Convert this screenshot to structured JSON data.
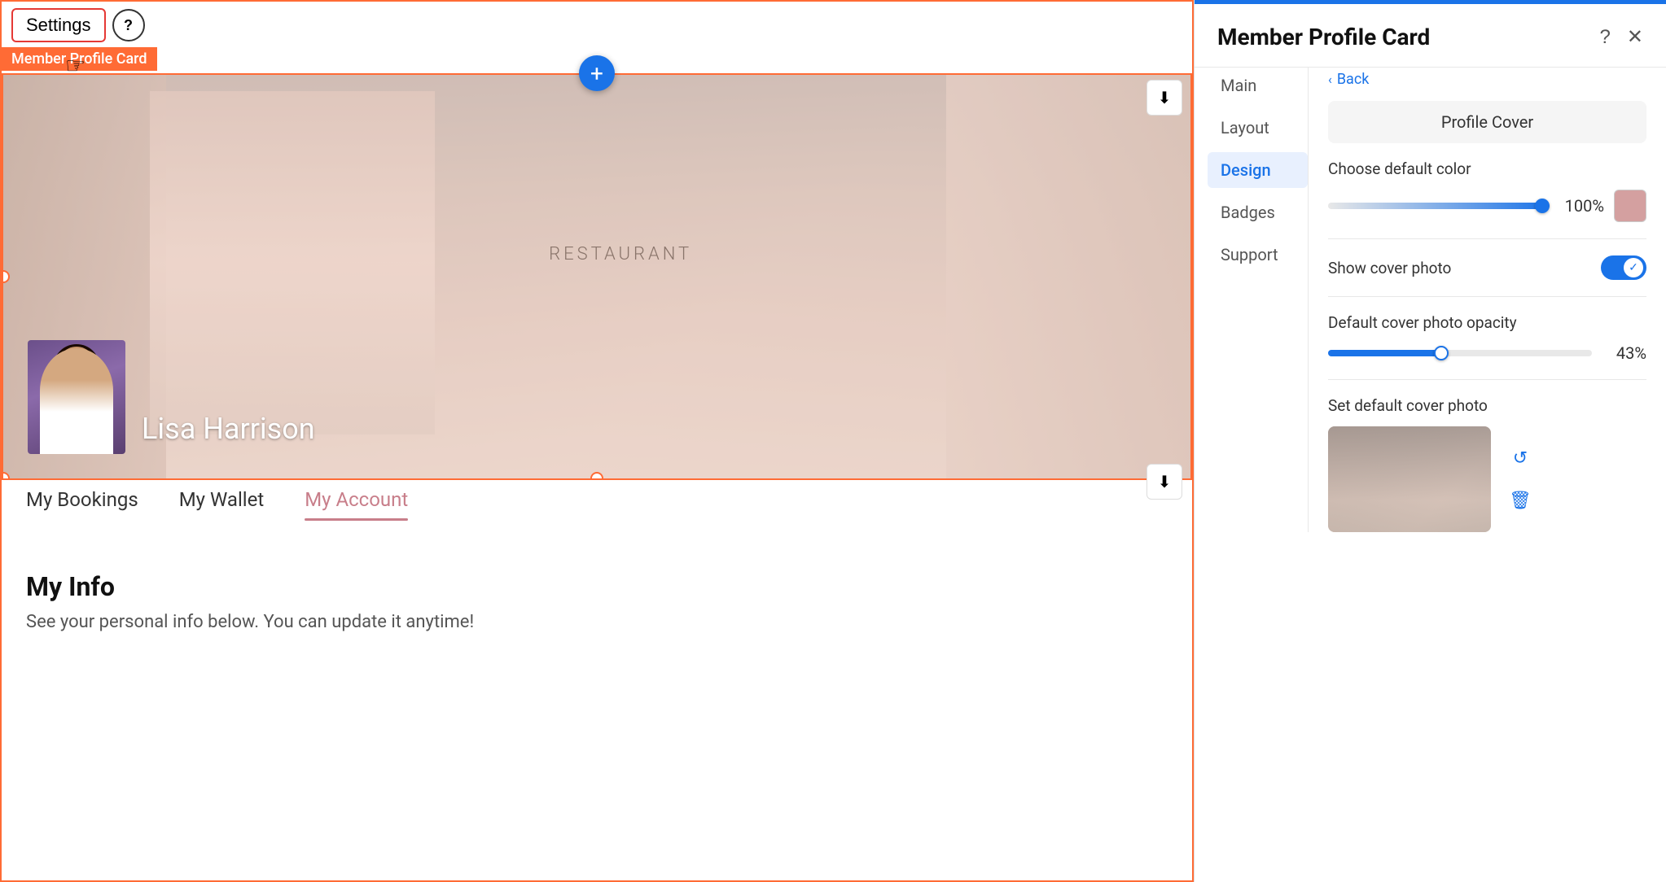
{
  "toolbar": {
    "settings_label": "Settings",
    "help_label": "?",
    "widget_label": "Member Profile Card"
  },
  "cover": {
    "restaurant_text": "RESTAURANT",
    "profile_name": "Lisa Harrison",
    "add_btn": "+",
    "download_symbol": "⬇"
  },
  "tabs": {
    "items": [
      {
        "label": "My Bookings",
        "active": false
      },
      {
        "label": "My Wallet",
        "active": false
      },
      {
        "label": "My Account",
        "active": true
      }
    ]
  },
  "my_info": {
    "title": "My Info",
    "subtitle": "See your personal info below. You can update it anytime!"
  },
  "panel": {
    "title": "Member Profile Card",
    "help_icon": "?",
    "close_icon": "✕",
    "back_label": "Back",
    "section_header": "Profile Cover",
    "nav_items": [
      {
        "label": "Main",
        "active": false
      },
      {
        "label": "Layout",
        "active": false
      },
      {
        "label": "Design",
        "active": true
      },
      {
        "label": "Badges",
        "active": false
      },
      {
        "label": "Support",
        "active": false
      }
    ],
    "settings": {
      "choose_default_color_label": "Choose default color",
      "color_percent": "100%",
      "show_cover_photo_label": "Show cover photo",
      "opacity_label": "Default cover photo opacity",
      "opacity_percent": "43%",
      "set_default_photo_label": "Set default cover photo"
    }
  }
}
